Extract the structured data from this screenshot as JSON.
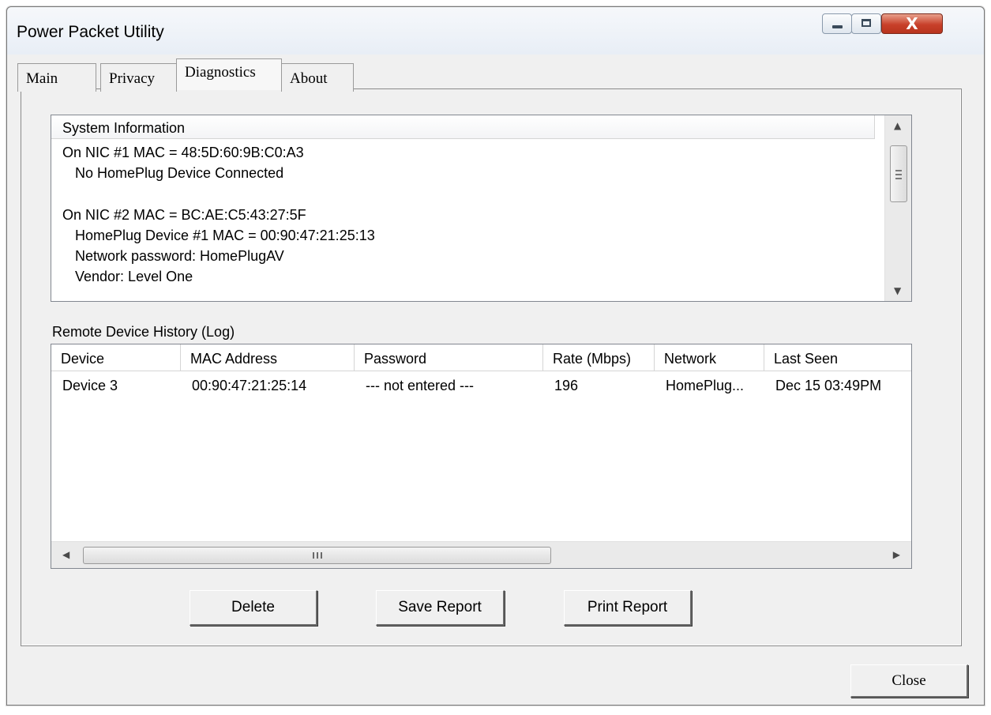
{
  "window": {
    "title": "Power Packet Utility",
    "close_glyph": "X"
  },
  "tabs": [
    {
      "label": "Main",
      "active": false
    },
    {
      "label": "Privacy",
      "active": false
    },
    {
      "label": "Diagnostics",
      "active": true
    },
    {
      "label": "About",
      "active": false
    }
  ],
  "system_information": {
    "header": "System Information",
    "lines": [
      "On NIC #1 MAC = 48:5D:60:9B:C0:A3",
      "No HomePlug Device Connected",
      "",
      "On NIC #2 MAC = BC:AE:C5:43:27:5F",
      "HomePlug Device #1 MAC = 00:90:47:21:25:13",
      "Network password: HomePlugAV",
      "Vendor: Level One"
    ]
  },
  "remote_log": {
    "label": "Remote Device History (Log)",
    "columns": [
      "Device",
      "MAC Address",
      "Password",
      "Rate (Mbps)",
      "Network",
      "Last Seen"
    ],
    "rows": [
      [
        "Device 3",
        "00:90:47:21:25:14",
        "--- not entered ---",
        "196",
        "HomePlug...",
        "Dec 15 03:49PM"
      ]
    ],
    "hscroll_grip": "III"
  },
  "buttons": {
    "delete": "Delete",
    "save_report": "Save Report",
    "print_report": "Print Report",
    "close": "Close"
  },
  "icons": {
    "minimize": "minimize-icon",
    "maximize": "maximize-icon",
    "close": "close-icon",
    "scroll_up": "arrow-up-icon",
    "scroll_down": "arrow-down-icon",
    "scroll_left": "arrow-left-icon",
    "scroll_right": "arrow-right-icon"
  },
  "colors": {
    "window_bg": "#f0f0f0",
    "close_button": "#c8402a",
    "list_bg": "#ffffff"
  }
}
